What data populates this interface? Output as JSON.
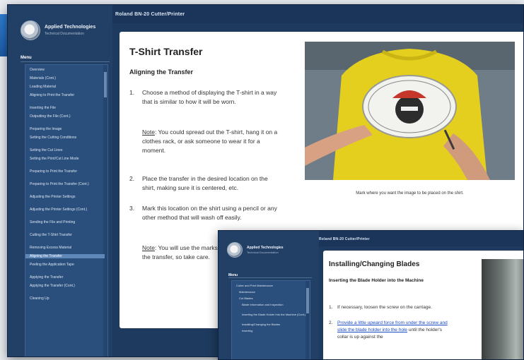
{
  "main_window": {
    "title": "Roland BN-20 Cutter/Printer",
    "company": "Applied Technologies",
    "company_sub": "Technical Documentation",
    "menu_label": "Menu",
    "menu_items": [
      "Overview",
      "Materials (Cont.)",
      "Loading Material",
      "Aligning to Print the Transfer",
      "Inserting the File",
      "Outputting the File (Cont.)",
      "Preparing the Image",
      "Setting the Cutting Conditions",
      "Setting the Cut Lines",
      "Setting the Print/Cut Line Mode",
      "Preparing to Print the Transfer",
      "Preparing to Print the Transfer (Cont.)",
      "Adjusting the Printer Settings",
      "Adjusting the Printer Settings (Cont.)",
      "Sending the File and Printing",
      "Cutting the T-Shirt Transfer",
      "Removing Excess Material",
      "Aligning the Transfer",
      "Peeling the Application Tape",
      "Applying the Transfer",
      "Applying the Transfer (Cont.)",
      "Cleaning Up"
    ],
    "selected_index": 17,
    "page_title": "T-Shirt Transfer",
    "section_title": "Aligning the Transfer",
    "steps": [
      {
        "num": "1.",
        "text": "Choose a method of displaying the T-shirt in a way that is similar to how it will be worn."
      },
      {
        "num": "2.",
        "text": "Place the transfer in the desired location on the shirt, making sure it is centered, etc."
      },
      {
        "num": "3.",
        "text": "Mark this location on the shirt using a pencil or any other method that will wash off easily."
      }
    ],
    "note1_label": "Note",
    "note1_text": ": You could spread out the T-shirt, hang it on a clothes rack, or ask someone to wear it for a moment.",
    "note2_label": "Note",
    "note2_text": ": You will use the marks as a guide for placing the transfer, so take care.",
    "photo_caption": "Mark where you want the image to be placed on the shirt."
  },
  "second_window": {
    "title": "Roland BN-20 Cutter/Printer",
    "company": "Applied Technologies",
    "company_sub": "Technical Documentation",
    "menu_label": "Menu",
    "menu_items": [
      "Cutter and Print Maintenance",
      "Maintenance",
      "Cut Blades",
      "Blade Information and Inspection",
      "Inserting the Blade Holder Into the Machine (Cont.)",
      "Installing/Changing the Blades",
      "Inserting"
    ],
    "page_title": "Installing/Changing Blades",
    "section_title": "Inserting the Blade Holder into the Machine",
    "steps": [
      {
        "num": "1.",
        "text": "If necessary, loosen the screw on the carriage."
      },
      {
        "num": "2.",
        "link": "Provide a little upward force from under the screw and slide the blade holder into the hole",
        "text": " until the holder's collar is up against the"
      }
    ]
  }
}
